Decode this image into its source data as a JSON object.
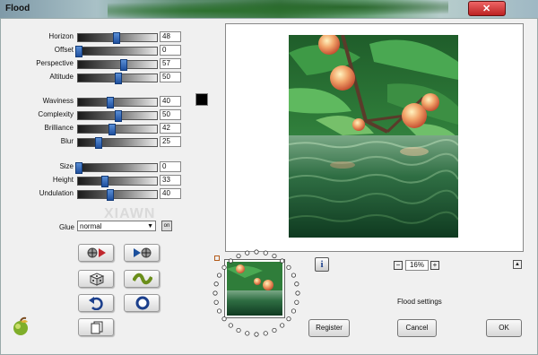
{
  "window": {
    "title": "Flood"
  },
  "params": [
    {
      "label": "Horizon",
      "value": "48",
      "level": 0.48
    },
    {
      "label": "Offset",
      "value": "0",
      "level": 0.0
    },
    {
      "label": "Perspective",
      "value": "57",
      "level": 0.57
    },
    {
      "label": "Altitude",
      "value": "50",
      "level": 0.5
    },
    {
      "label": "Waviness",
      "value": "40",
      "level": 0.4
    },
    {
      "label": "Complexity",
      "value": "50",
      "level": 0.5
    },
    {
      "label": "Brilliance",
      "value": "42",
      "level": 0.42
    },
    {
      "label": "Blur",
      "value": "25",
      "level": 0.25
    },
    {
      "label": "Size",
      "value": "0",
      "level": 0.0
    },
    {
      "label": "Height",
      "value": "33",
      "level": 0.33
    },
    {
      "label": "Undulation",
      "value": "40",
      "level": 0.4
    }
  ],
  "swatch_color": "#000000",
  "glue": {
    "label": "Glue",
    "value": "normal"
  },
  "watermark": "XIAWN",
  "zoom": {
    "value": "16%"
  },
  "info_label": "i",
  "status": "Flood settings",
  "buttons": {
    "register": "Register",
    "cancel": "Cancel",
    "ok": "OK"
  }
}
